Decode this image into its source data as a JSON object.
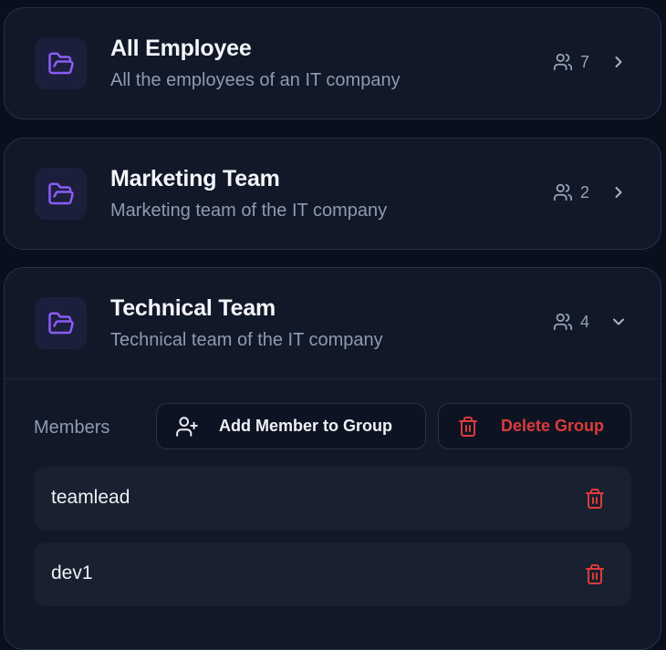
{
  "groups": [
    {
      "title": "All Employee",
      "description": "All the employees of an IT company",
      "member_count": "7",
      "expanded": false
    },
    {
      "title": "Marketing Team",
      "description": "Marketing team of the IT company",
      "member_count": "2",
      "expanded": false
    },
    {
      "title": "Technical Team",
      "description": "Technical team of the IT company",
      "member_count": "4",
      "expanded": true
    }
  ],
  "members_panel": {
    "label": "Members",
    "add_button_label": "Add Member to Group",
    "delete_button_label": "Delete Group",
    "members": [
      {
        "name": "teamlead"
      },
      {
        "name": "dev1"
      }
    ]
  },
  "colors": {
    "accent_purple": "#8b5cf6",
    "danger_red": "#dc3b3b",
    "card_bg": "#111828",
    "page_bg": "#0a0f1d"
  },
  "icons": {
    "group": "folder-open-icon",
    "count": "users-icon",
    "collapsed": "chevron-right-icon",
    "expanded": "chevron-down-icon",
    "add_member": "user-plus-icon",
    "delete": "trash-icon"
  }
}
